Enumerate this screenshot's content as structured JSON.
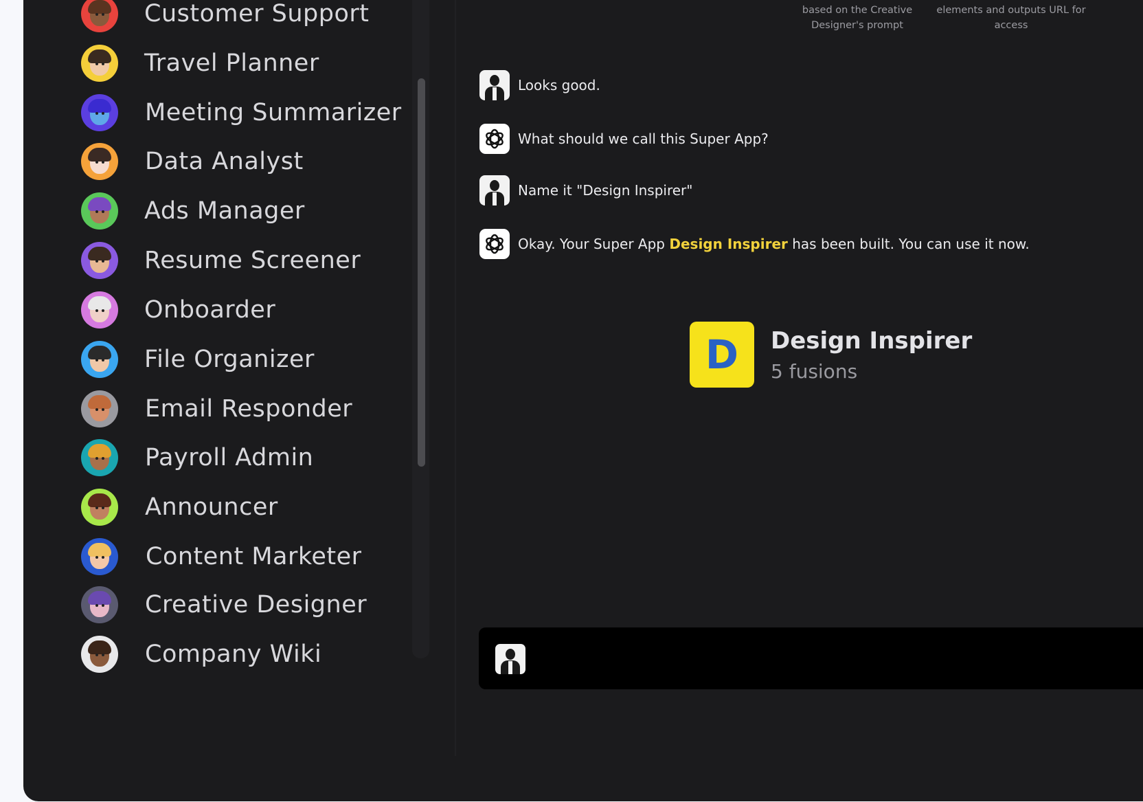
{
  "sidebar": {
    "agents": [
      {
        "label": "Customer Support",
        "bg": "#e8433d",
        "skin": "#8a5a3c",
        "hair": "#5a3420"
      },
      {
        "label": "Travel Planner",
        "bg": "#f5cf3a",
        "skin": "#f0c9a8",
        "hair": "#3a2a20"
      },
      {
        "label": "Meeting Summarizer",
        "bg": "#5b3fe0",
        "skin": "#5fa8e8",
        "hair": "#3a2bd0"
      },
      {
        "label": "Data Analyst",
        "bg": "#f5a23a",
        "skin": "#f6dcd0",
        "hair": "#3a2a24"
      },
      {
        "label": "Ads Manager",
        "bg": "#5ac85a",
        "skin": "#b07a58",
        "hair": "#7a4ac0"
      },
      {
        "label": "Resume Screener",
        "bg": "#8a5ae0",
        "skin": "#e8b894",
        "hair": "#3a2a20"
      },
      {
        "label": "Onboarder",
        "bg": "#d67ae0",
        "skin": "#f0d0c8",
        "hair": "#e8e8e8"
      },
      {
        "label": "File Organizer",
        "bg": "#3aa6f0",
        "skin": "#f0c8a8",
        "hair": "#2a2a2a"
      },
      {
        "label": "Email Responder",
        "bg": "#9a9aa0",
        "skin": "#d8906a",
        "hair": "#c06a3a"
      },
      {
        "label": "Payroll Admin",
        "bg": "#1aa6b0",
        "skin": "#a8704a",
        "hair": "#e0a030"
      },
      {
        "label": "Announcer",
        "bg": "#a8e84a",
        "skin": "#c08060",
        "hair": "#5a2a1a"
      },
      {
        "label": "Content Marketer",
        "bg": "#2a5ad0",
        "skin": "#f4c8a8",
        "hair": "#f0c060"
      },
      {
        "label": "Creative Designer",
        "bg": "#5a5a70",
        "skin": "#e8b8c8",
        "hair": "#6a4ab0"
      },
      {
        "label": "Company Wiki",
        "bg": "#e8e8ea",
        "skin": "#8a5a3c",
        "hair": "#3a2418"
      }
    ]
  },
  "header_captions": [
    {
      "text": "based on the Creative Designer's prompt"
    },
    {
      "text": "elements and outputs URL for access"
    }
  ],
  "chat": {
    "messages": [
      {
        "role": "user",
        "text": "Looks good."
      },
      {
        "role": "bot",
        "text": "What should we call this Super App?"
      },
      {
        "role": "user",
        "text": "Name it \"Design Inspirer\""
      },
      {
        "role": "bot",
        "text_before": "Okay. Your Super App ",
        "highlight": "Design Inspirer",
        "text_after": " has been built. You can use it now."
      }
    ],
    "app_card": {
      "logo_letter": "D",
      "title": "Design Inspirer",
      "subtitle": "5 fusions"
    }
  },
  "colors": {
    "highlight": "#f2d23c",
    "app_logo_bg": "#f6e21b",
    "app_logo_letter": "#2a62c4"
  }
}
